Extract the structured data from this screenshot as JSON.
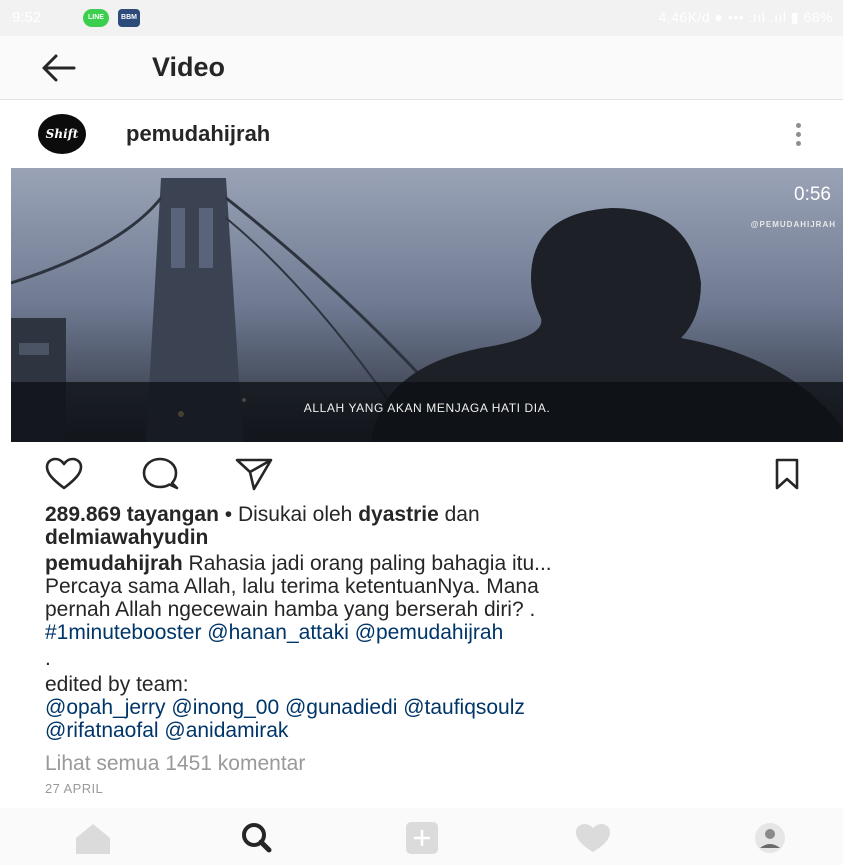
{
  "status_bar": {
    "time": "9:52",
    "line_icon": "LINE",
    "bbm_icon": "BBM",
    "right_text": "4,46K/d   ●  •••  .ııl  .ııl  ▮ 68%"
  },
  "appbar": {
    "title": "Video",
    "back_icon": "back-arrow-icon"
  },
  "post": {
    "username": "pemudahijrah",
    "avatar_text": "Shift",
    "video": {
      "duration": "0:56",
      "watermark": "@PEMUDAHIJRAH",
      "subtitle": "ALLAH YANG AKAN MENJAGA HATI DIA."
    },
    "views": "289.869 tayangan",
    "liked_prefix": "• Disukai oleh",
    "liked_user1": "dyastrie",
    "liked_and": "dan",
    "liked_user2": "delmiawahyudin",
    "caption_user": "pemudahijrah",
    "caption_line1": "Rahasia jadi orang paling bahagia itu...",
    "caption_line2": "Percaya sama Allah, lalu terima ketentuanNya. Mana",
    "caption_line3": "pernah Allah ngecewain hamba yang berserah diri? .",
    "caption_tags": "#1minutebooster @hanan_attaki @pemudahijrah",
    "caption_dot": ".",
    "edited_by": "edited by team:",
    "mentions1": "@opah_jerry @inong_00 @gunadiedi @taufiqsoulz",
    "mentions2": "@rifatnaofal @anidamirak",
    "view_comments": "Lihat semua 1451 komentar",
    "date": "27 APRIL"
  },
  "colors": {
    "text": "#262626",
    "link": "#003569",
    "muted": "#999999",
    "nav_inactive": "#dbdbdb"
  },
  "bottom_nav": [
    "home-icon",
    "search-icon",
    "add-icon",
    "heart-icon",
    "profile-avatar"
  ]
}
